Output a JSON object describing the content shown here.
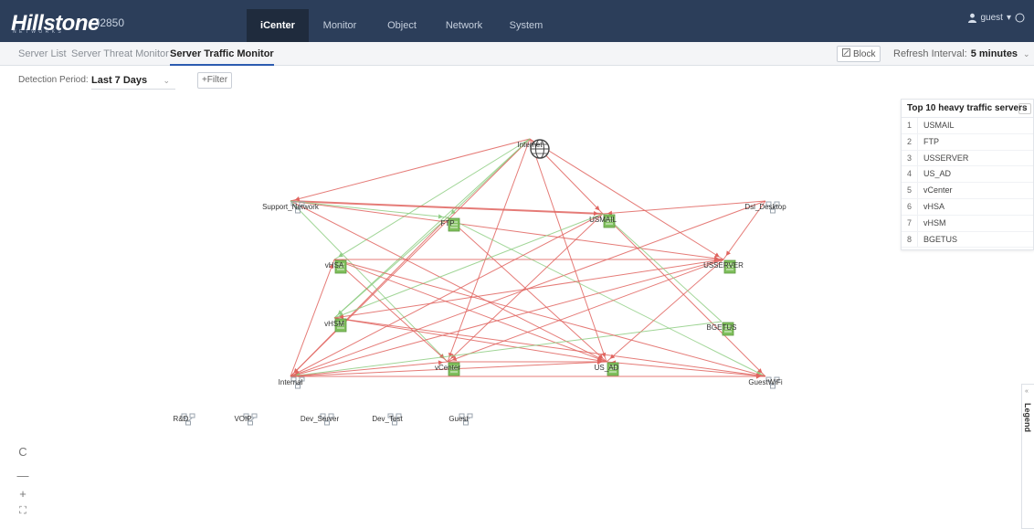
{
  "app": {
    "logo": "Hillstone",
    "logo_tagline": "NETWORKS",
    "model": "I2850"
  },
  "nav": {
    "tabs": [
      {
        "label": "iCenter",
        "active": true
      },
      {
        "label": "Monitor",
        "active": false
      },
      {
        "label": "Object",
        "active": false
      },
      {
        "label": "Network",
        "active": false
      },
      {
        "label": "System",
        "active": false
      }
    ],
    "user": "guest"
  },
  "subnav": {
    "tabs": [
      {
        "label": "Server List",
        "active": false
      },
      {
        "label": "Server Threat Monitor",
        "active": false
      },
      {
        "label": "Server Traffic Monitor",
        "active": true
      }
    ],
    "block_label": "Block",
    "refresh_label": "Refresh Interval:",
    "refresh_value": "5 minutes"
  },
  "filters": {
    "detection_label": "Detection Period:",
    "detection_value": "Last 7 Days",
    "filter_label": "+Filter"
  },
  "topology": {
    "nodes": [
      {
        "id": "internet",
        "label": "Internet",
        "kind": "globe-icon"
      },
      {
        "id": "support",
        "label": "Support_Network",
        "kind": "network-icon"
      },
      {
        "id": "ftp",
        "label": "FTP",
        "kind": "server-icon"
      },
      {
        "id": "usmail",
        "label": "USMAIL",
        "kind": "server-icon"
      },
      {
        "id": "dsl",
        "label": "Dsl_Desktop",
        "kind": "network-icon"
      },
      {
        "id": "vhsa",
        "label": "vHSA",
        "kind": "server-icon"
      },
      {
        "id": "usserver",
        "label": "USSERVER",
        "kind": "server-icon"
      },
      {
        "id": "vhsm",
        "label": "vHSM",
        "kind": "server-icon"
      },
      {
        "id": "bgetus",
        "label": "BGETUS",
        "kind": "server-icon"
      },
      {
        "id": "intranet",
        "label": "Internal",
        "kind": "network-icon"
      },
      {
        "id": "vcenter",
        "label": "vCenter",
        "kind": "server-icon"
      },
      {
        "id": "usad",
        "label": "US_AD",
        "kind": "server-icon"
      },
      {
        "id": "guestwifi",
        "label": "GuestWiFi",
        "kind": "network-icon"
      },
      {
        "id": "rd",
        "label": "R&D",
        "kind": "network-icon"
      },
      {
        "id": "voip",
        "label": "VOIP",
        "kind": "network-icon"
      },
      {
        "id": "devserver",
        "label": "Dev_Server",
        "kind": "network-icon"
      },
      {
        "id": "devtest",
        "label": "Dev_Test",
        "kind": "network-icon"
      },
      {
        "id": "guest",
        "label": "Guest",
        "kind": "network-icon"
      }
    ],
    "colors": {
      "red_link": "#e0645f",
      "green_link": "#8fce84",
      "server": "#7fbf5c",
      "network": "#9aa3ad"
    }
  },
  "top_servers": {
    "title": "Top 10 heavy traffic servers",
    "items": [
      {
        "rank": "1",
        "name": "USMAIL"
      },
      {
        "rank": "2",
        "name": "FTP"
      },
      {
        "rank": "3",
        "name": "USSERVER"
      },
      {
        "rank": "4",
        "name": "US_AD"
      },
      {
        "rank": "5",
        "name": "vCenter"
      },
      {
        "rank": "6",
        "name": "vHSA"
      },
      {
        "rank": "7",
        "name": "vHSM"
      },
      {
        "rank": "8",
        "name": "BGETUS"
      }
    ]
  },
  "legend": {
    "label": "Legend"
  },
  "zoom": {
    "refresh_symbol": "C",
    "minus_symbol": "—",
    "plus_symbol": "+",
    "fit_symbol": "⛶"
  }
}
